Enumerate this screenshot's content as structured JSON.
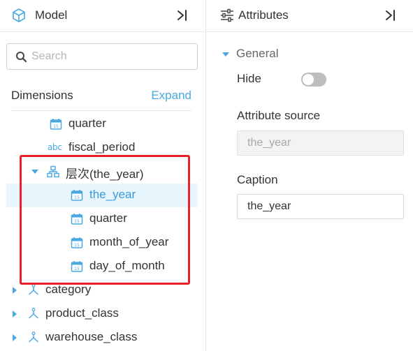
{
  "model_panel": {
    "title": "Model",
    "title_icon": "cube-icon",
    "collapse_icon": "collapse-right-icon",
    "search": {
      "placeholder": "Search",
      "value": ""
    },
    "dimensions_label": "Dimensions",
    "expand_label": "Expand",
    "tree": [
      {
        "label": "quarter",
        "icon": "calendar-icon",
        "expanded": null,
        "selected": false
      },
      {
        "label": "fiscal_period",
        "icon": "abc-text-icon",
        "icon_text": "abc",
        "expanded": null,
        "selected": false
      },
      {
        "label": "层次(the_year)",
        "icon": "hierarchy-icon",
        "expanded": true,
        "selected": false
      },
      {
        "label": "the_year",
        "icon": "calendar-icon",
        "expanded": null,
        "selected": true
      },
      {
        "label": "quarter",
        "icon": "calendar-icon",
        "expanded": null,
        "selected": false
      },
      {
        "label": "month_of_year",
        "icon": "calendar-icon",
        "expanded": null,
        "selected": false
      },
      {
        "label": "day_of_month",
        "icon": "calendar-icon",
        "expanded": null,
        "selected": false
      },
      {
        "label": "category",
        "icon": "dimension-icon",
        "expanded": false,
        "selected": false
      },
      {
        "label": "product_class",
        "icon": "dimension-icon",
        "expanded": false,
        "selected": false
      },
      {
        "label": "warehouse_class",
        "icon": "dimension-icon",
        "expanded": false,
        "selected": false
      }
    ],
    "highlight_color": "#e8202a"
  },
  "attributes_panel": {
    "title": "Attributes",
    "title_icon": "sliders-icon",
    "collapse_icon": "collapse-right-icon",
    "section_title": "General",
    "hide_label": "Hide",
    "hide_on": false,
    "attribute_source_label": "Attribute source",
    "attribute_source_value": "the_year",
    "caption_label": "Caption",
    "caption_value": "the_year"
  },
  "colors": {
    "accent": "#4aa8e0",
    "selected_bg": "#e7f5fc",
    "selected_text": "#3a9ad9"
  }
}
